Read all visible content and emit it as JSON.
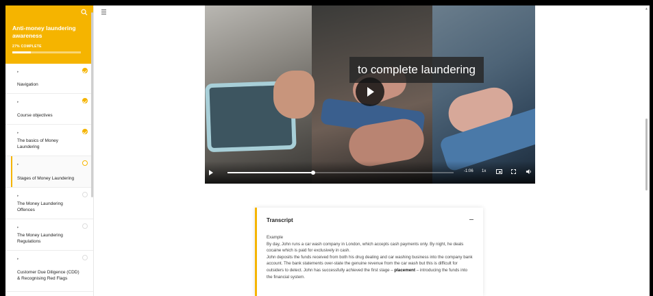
{
  "course": {
    "title": "Anti-money laundering awareness",
    "progress_label": "27% COMPLETE",
    "progress_value": 0.27
  },
  "sidebar": {
    "items": [
      {
        "label": "Navigation",
        "status": "done"
      },
      {
        "label": "Course objectives",
        "status": "done"
      },
      {
        "label": "The basics of Money Laundering",
        "status": "done"
      },
      {
        "label": "Stages of Money Laundering",
        "status": "current"
      },
      {
        "label": "The Money Laundering Offences",
        "status": "todo"
      },
      {
        "label": "The Money Laundering Regulations",
        "status": "todo"
      },
      {
        "label": "Customer Due Diligence (CDD) & Recognising Red Flags",
        "status": "todo"
      }
    ]
  },
  "video": {
    "caption": "to complete laundering",
    "time": "-1:06",
    "speed": "1x",
    "progress": 0.38
  },
  "transcript": {
    "title": "Transcript",
    "example_label": "Example",
    "paragraph1": "By day, John runs a car wash company in London, which accepts cash payments only. By night, he deals cocaine which is paid for exclusively in cash.",
    "paragraph2_a": "John deposits the funds received from both his drug dealing and car washing business into the company bank account.  The bank statements over-state the genuine revenue from the car wash but this is difficult for outsiders to detect. John has successfully achieved the first stage – ",
    "paragraph2_bold": "placement",
    "paragraph2_b": " – introducing the funds into the financial system."
  },
  "colors": {
    "accent": "#f5b400"
  },
  "icons": {
    "search": "search-icon",
    "menu": "hamburger-menu-icon",
    "play": "play-icon"
  }
}
